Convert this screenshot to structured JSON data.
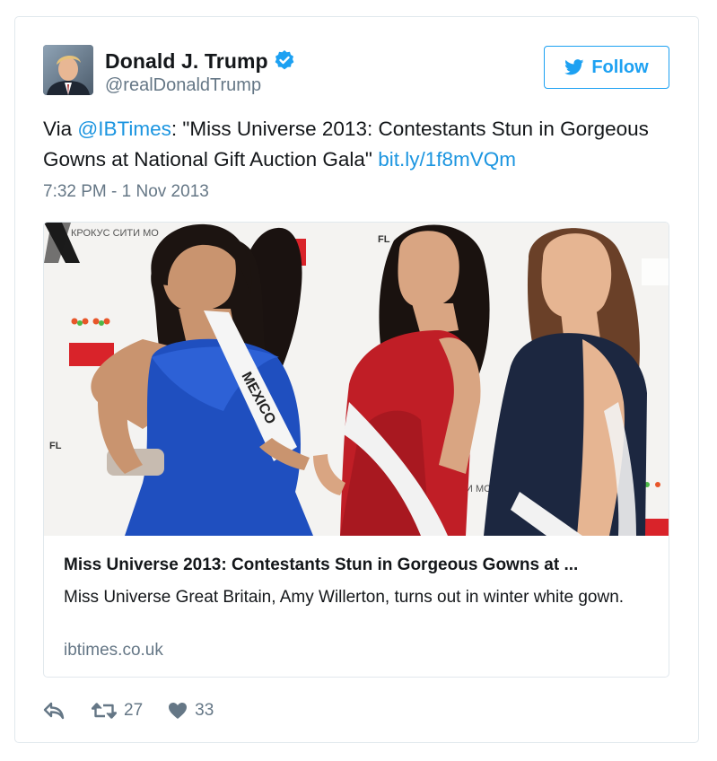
{
  "user": {
    "display_name": "Donald J. Trump",
    "handle": "@realDonaldTrump",
    "verified": true,
    "avatar_icon": "profile-photo"
  },
  "follow_button": {
    "label": "Follow",
    "icon": "twitter-bird-icon"
  },
  "tweet": {
    "text_prefix": "Via ",
    "mention": "@IBTimes",
    "text_body": ": \"Miss Universe 2013: Contestants Stun in Gorgeous Gowns at National Gift Auction Gala\" ",
    "link": "bit.ly/1f8mVQm",
    "timestamp": "7:32 PM - 1 Nov 2013"
  },
  "card": {
    "image_sash_text": "MEXICO",
    "backdrop_text": "КРОКУС СИТИ МО",
    "title": "Miss Universe 2013: Contestants Stun in Gorgeous Gowns at ...",
    "description": "Miss Universe Great Britain, Amy Willerton, turns out in winter white gown.",
    "domain": "ibtimes.co.uk"
  },
  "actions": {
    "reply_icon": "reply-icon",
    "retweet_icon": "retweet-icon",
    "retweet_count": "27",
    "like_icon": "heart-icon",
    "like_count": "33"
  },
  "colors": {
    "accent": "#1da1f2",
    "link": "#1b95e0",
    "muted": "#657786",
    "text": "#14171a",
    "border": "#e1e8ed"
  }
}
